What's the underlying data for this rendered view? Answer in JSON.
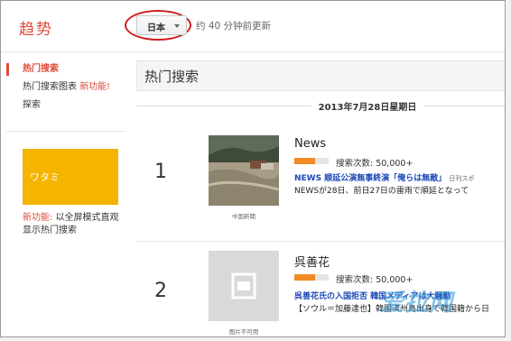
{
  "header": {
    "brand": "趋势",
    "region_value": "日本",
    "update_text": "约 40 分钟前更新"
  },
  "sidebar": {
    "items": [
      {
        "label": "热门搜索",
        "active": true
      },
      {
        "label": "热门搜索图表",
        "tag": "新功能!"
      },
      {
        "label": "探索"
      }
    ],
    "promo_text": "ワタミ",
    "note_tag": "新功能:",
    "note_text": "以全屏模式直观显示热门搜索"
  },
  "main": {
    "section_title": "热门搜索",
    "date": "2013年7月28日星期日",
    "trends": [
      {
        "rank": "1",
        "title": "News",
        "search_label": "搜索次数: 50,000+",
        "popularity": 0.6,
        "image_caption": "中国新聞",
        "headline": "NEWS 顺延公演無事終演「俺らは無敵」",
        "headline_source": "日刊スポ",
        "snippet": "NEWSが28日、前日27日の雷雨で順延となって"
      },
      {
        "rank": "2",
        "title": "呉善花",
        "search_label": "搜索次数: 50,000+",
        "popularity": 0.6,
        "image_caption": "图片不可用",
        "headline": "呉善花氏の入国拒否 韓国メディアは大騒動",
        "snippet": "【ソウル＝加藤達也】韓国済州島出身で韓国籍から日"
      }
    ]
  },
  "watermark": "爱拉网",
  "colors": {
    "accent": "#dd4b39",
    "promo": "#f4b400",
    "bar": "#f08a24",
    "link": "#1a47b8"
  }
}
